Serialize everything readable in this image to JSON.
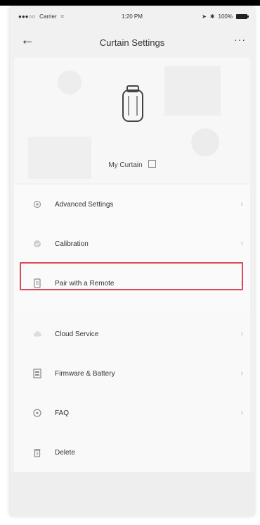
{
  "status_bar": {
    "carrier": "Carrier",
    "time": "1:20 PM",
    "battery": "100%"
  },
  "nav": {
    "title": "Curtain Settings",
    "more_label": "···"
  },
  "device": {
    "name": "My Curtain"
  },
  "groups": [
    {
      "items": [
        {
          "label": "Advanced Settings",
          "icon": "gear-icon"
        },
        {
          "label": "Calibration",
          "icon": "check-circle-icon"
        },
        {
          "label": "Pair with a Remote",
          "icon": "remote-icon",
          "highlighted": true
        }
      ]
    },
    {
      "items": [
        {
          "label": "Cloud Service",
          "icon": "cloud-icon"
        },
        {
          "label": "Firmware & Battery",
          "icon": "firmware-icon"
        },
        {
          "label": "FAQ",
          "icon": "faq-icon"
        },
        {
          "label": "Delete",
          "icon": "trash-icon"
        }
      ]
    }
  ],
  "colors": {
    "highlight": "#d94b54",
    "background": "#f1f1f1"
  }
}
